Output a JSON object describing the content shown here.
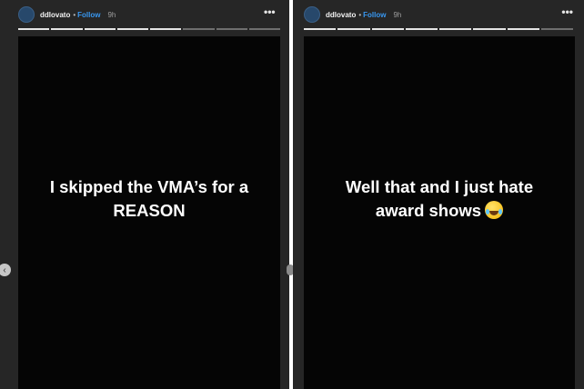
{
  "stories": [
    {
      "username": "ddlovato",
      "separator": "•",
      "follow_label": "Follow",
      "time": "9h",
      "more_icon": "•••",
      "progress": {
        "segments": 8,
        "completed": 5
      },
      "text": "I skipped the VMA’s for a REASON"
    },
    {
      "username": "ddlovato",
      "separator": "•",
      "follow_label": "Follow",
      "time": "9h",
      "more_icon": "•••",
      "progress": {
        "segments": 8,
        "completed": 7
      },
      "text": "Well that and I just hate award shows",
      "emoji": "grinning-squinting-face-with-tears"
    }
  ],
  "navigation": {
    "prev_icon": "‹"
  },
  "colors": {
    "accent": "#3897f0",
    "story_bg": "#050505",
    "chrome_bg": "#262626"
  }
}
